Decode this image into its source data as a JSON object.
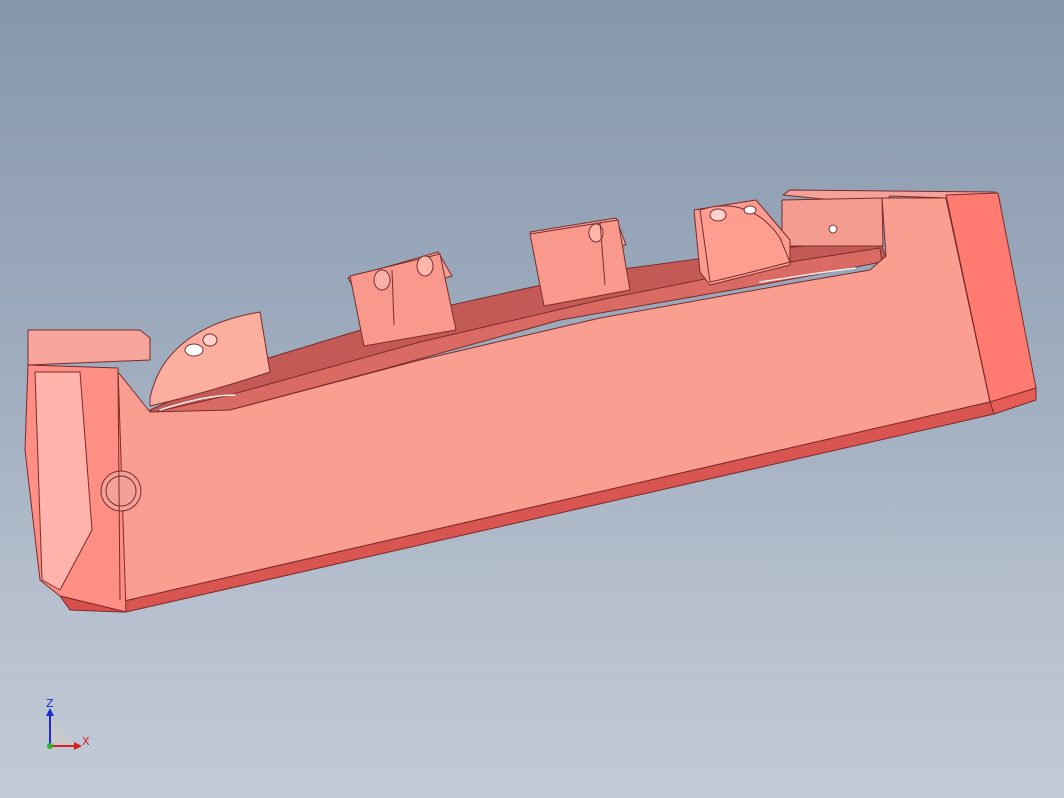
{
  "viewport": {
    "background_top": "#8797ab",
    "background_bottom": "#c2cad6"
  },
  "model": {
    "base_color": "#f99c90",
    "shade_color": "#e9615c",
    "dark_color": "#c84d4b",
    "edge_color": "#7a2c2a"
  },
  "triad": {
    "z_label": "Z",
    "x_label": "X",
    "z_color": "#1f2bd6",
    "x_color": "#d61f1f",
    "y_color": "#2bb52b"
  }
}
